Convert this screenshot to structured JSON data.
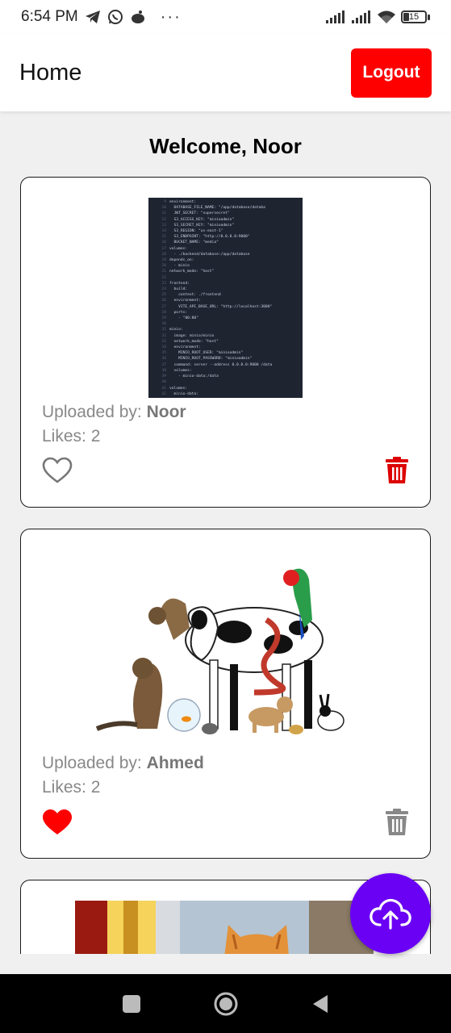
{
  "status_bar": {
    "time": "6:54 PM",
    "battery": "15",
    "icons": [
      "telegram-icon",
      "whatsapp-icon",
      "app-icon",
      "more-icon",
      "signal-icon",
      "signal-icon",
      "wifi-icon",
      "battery-icon"
    ]
  },
  "appbar": {
    "title": "Home",
    "logout_label": "Logout"
  },
  "welcome": "Welcome, Noor",
  "posts": [
    {
      "uploaded_by_label": "Uploaded by:",
      "uploader": "Noor",
      "likes_label": "Likes: 2",
      "liked": false,
      "trash_color": "#dd0000",
      "image": "code-screenshot"
    },
    {
      "uploaded_by_label": "Uploaded by:",
      "uploader": "Ahmed",
      "likes_label": "Likes: 2",
      "liked": true,
      "trash_color": "#888888",
      "image": "animals-photo"
    },
    {
      "image": "cat-photo"
    }
  ],
  "colors": {
    "logout": "#ff0000",
    "fab": "#6a00f4",
    "liked_heart": "#ff0000",
    "delete_active": "#dd0000"
  },
  "code_lines": [
    "environment:",
    "  DATABASE_FILE_NAME: \"/app/database/databa",
    "  JWT_SECRET: \"supersecret\"",
    "  S3_ACCESS_KEY: \"minioadmin\"",
    "  S3_SECRET_KEY: \"minioadmin\"",
    "  S3_REGION: \"us-east-1\"",
    "  S3_ENDPOINT: \"http://0.0.0.0:9000\"",
    "  BUCKET_NAME: \"media\"",
    "volumes:",
    "  - ./backend/database:/app/database",
    "depends_on:",
    "  - minio",
    "network_mode: \"host\"",
    "",
    "frontend:",
    "  build:",
    "    context: ./frontend",
    "  environment:",
    "    VITE_API_BASE_URL: \"http://localhost:3000\"",
    "  ports:",
    "    - \"80:80\"",
    "",
    "minio:",
    "  image: minio/minio",
    "  network_mode: \"host\"",
    "  environment:",
    "    MINIO_ROOT_USER: \"minioadmin\"",
    "    MINIO_ROOT_PASSWORD: \"minioadmin\"",
    "  command: server --address 0.0.0.0:9000 /data",
    "  volumes:",
    "    - minio-data:/data",
    "",
    "volumes:",
    "  minio-data:"
  ],
  "code_line_numbers": [
    "9",
    "10",
    "11",
    "12",
    "13",
    "14",
    "15",
    "16",
    "17",
    "18",
    "19",
    "20",
    "21",
    "22",
    "23",
    "24",
    "25",
    "26",
    "27",
    "28",
    "29",
    "30",
    "31",
    "32",
    "33",
    "34",
    "35",
    "36",
    "37",
    "38",
    "39",
    "40",
    "41",
    "42"
  ]
}
